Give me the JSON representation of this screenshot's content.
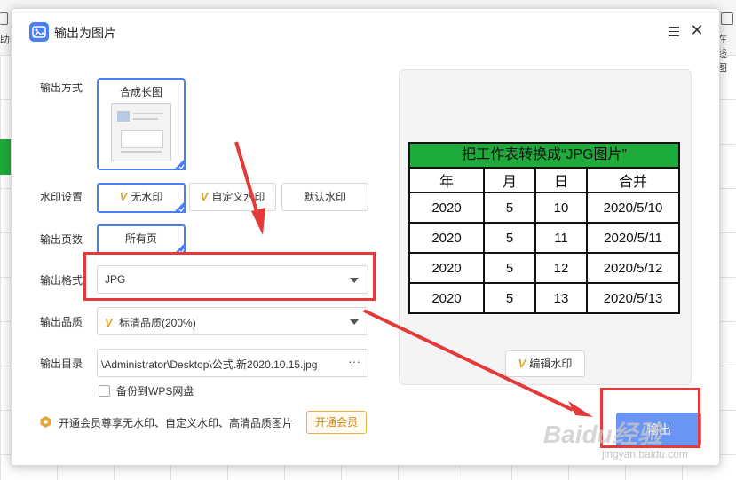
{
  "background": {
    "left_snippet": "助图",
    "right_snippet": "在线图"
  },
  "dialog": {
    "title": "输出为图片",
    "labels": {
      "mode": "输出方式",
      "watermark": "水印设置",
      "pages": "输出页数",
      "format": "输出格式",
      "quality": "输出品质",
      "directory": "输出目录"
    },
    "mode_option": "合成长图",
    "watermark_options": [
      "无水印",
      "自定义水印",
      "默认水印"
    ],
    "pages_option": "所有页",
    "format_value": "JPG",
    "quality_value": "标清品质(200%)",
    "directory_value": "\\Administrator\\Desktop\\公式.新2020.10.15.jpg",
    "directory_more": "···",
    "backup_label": "备份到WPS网盘",
    "vip_text": "开通会员尊享无水印、自定义水印、高清品质图片",
    "vip_button": "开通会员",
    "edit_watermark": "编辑水印",
    "output_button": "输出"
  },
  "preview": {
    "title": "把工作表转换成“JPG图片”",
    "headers": [
      "年",
      "月",
      "日",
      "合并"
    ],
    "rows": [
      [
        "2020",
        "5",
        "10",
        "2020/5/10"
      ],
      [
        "2020",
        "5",
        "11",
        "2020/5/11"
      ],
      [
        "2020",
        "5",
        "12",
        "2020/5/12"
      ],
      [
        "2020",
        "5",
        "13",
        "2020/5/13"
      ]
    ]
  },
  "watermark_text": "Baidu经验",
  "watermark_url": "jingyan.baidu.com",
  "colors": {
    "accent": "#4a7ef7",
    "annotation": "#e43a3a",
    "sheet_header": "#1faa3c",
    "vip": "#e6b04a"
  }
}
